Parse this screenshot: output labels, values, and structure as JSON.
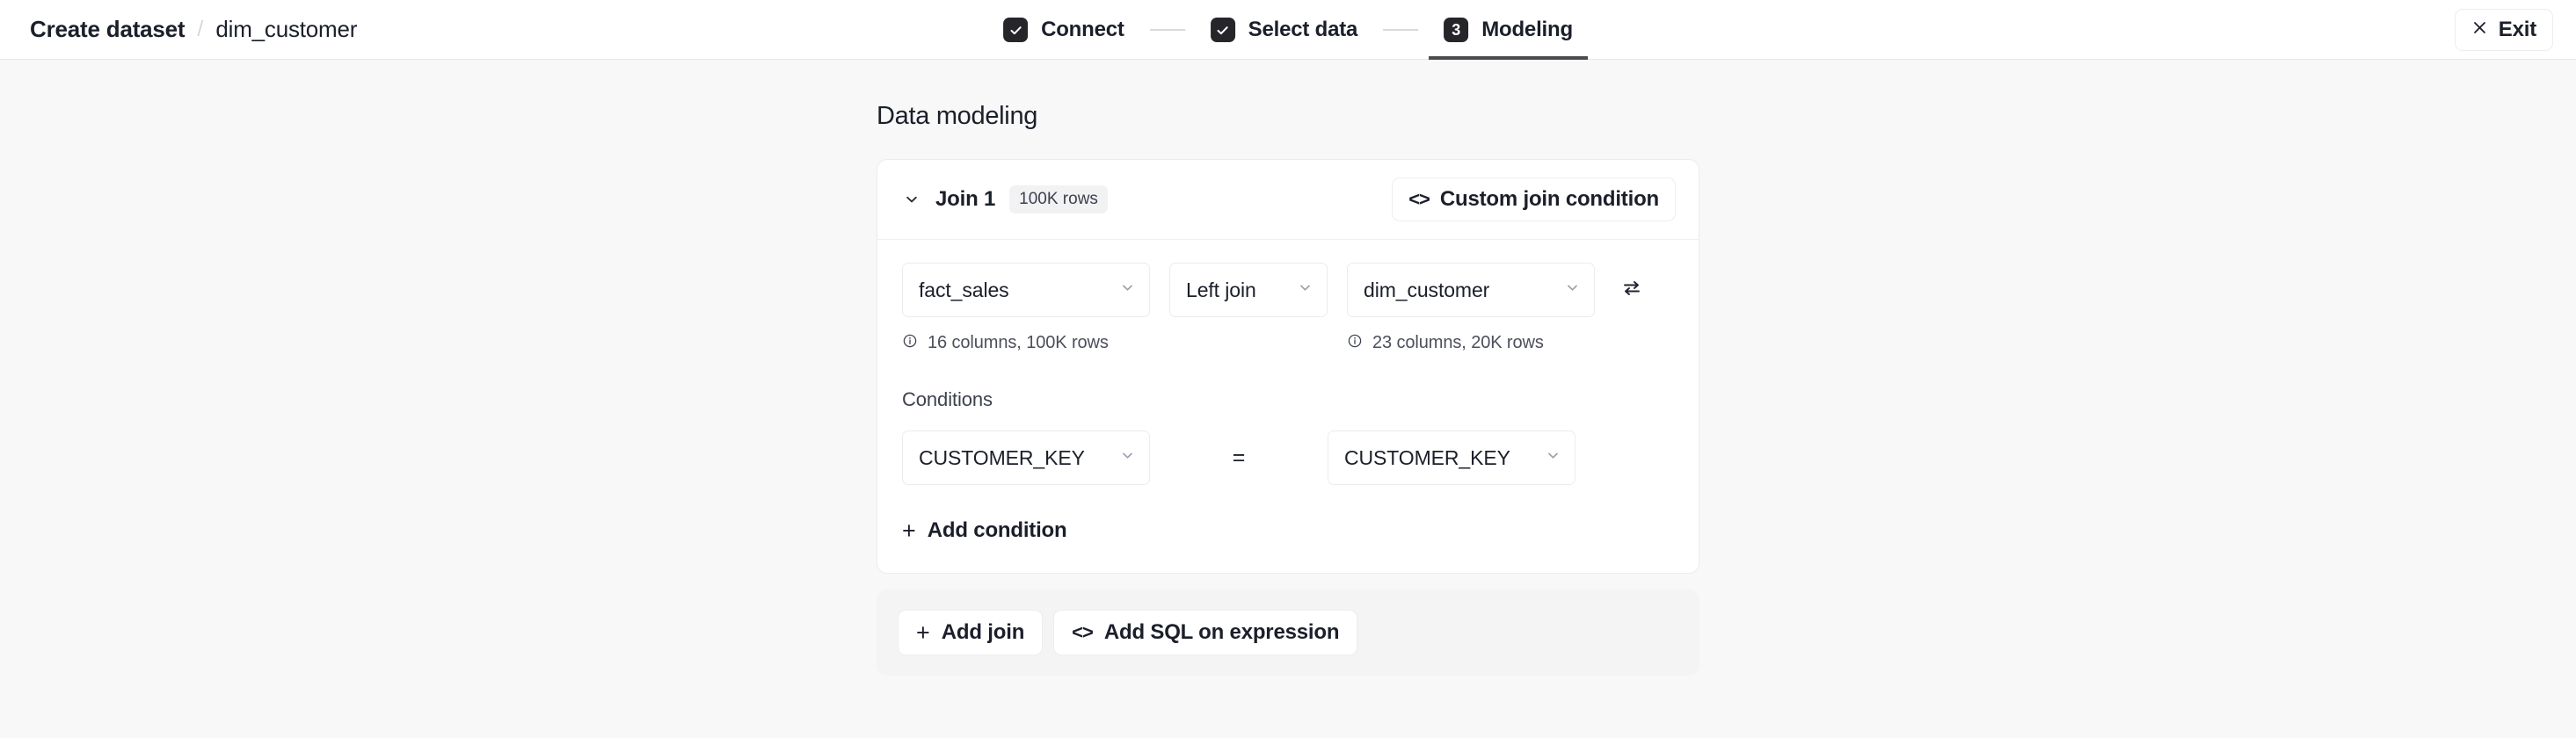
{
  "header": {
    "breadcrumb": {
      "root": "Create dataset",
      "separator": "/",
      "leaf": "dim_customer"
    },
    "steps": [
      {
        "label": "Connect",
        "marker": "check",
        "number": "",
        "state": "complete"
      },
      {
        "label": "Select data",
        "marker": "check",
        "number": "",
        "state": "complete"
      },
      {
        "label": "Modeling",
        "marker": "number",
        "number": "3",
        "state": "active"
      }
    ],
    "exit_button": {
      "label": "Exit",
      "icon": "close-icon"
    }
  },
  "main": {
    "title": "Data modeling",
    "join": {
      "collapse_icon": "chevron-down-icon",
      "title": "Join 1",
      "rows_badge": "100K rows",
      "custom_condition_button": {
        "label": "Custom join condition",
        "icon": "code-icon"
      },
      "left_table": {
        "value": "fact_sales",
        "meta": "16 columns, 100K rows"
      },
      "join_type": {
        "value": "Left join"
      },
      "right_table": {
        "value": "dim_customer",
        "meta": "23 columns, 20K rows"
      },
      "swap_icon": "swap-icon",
      "conditions_label": "Conditions",
      "conditions": [
        {
          "left": "CUSTOMER_KEY",
          "operator": "=",
          "right": "CUSTOMER_KEY"
        }
      ],
      "add_condition_button": {
        "label": "Add condition",
        "icon": "plus-icon"
      }
    },
    "footer_actions": [
      {
        "label": "Add join",
        "icon": "plus-icon"
      },
      {
        "label": "Add SQL on expression",
        "icon": "code-icon"
      }
    ]
  },
  "colors": {
    "page_background": "#f8f8f9",
    "surface": "#ffffff",
    "border": "#ececee",
    "text_primary": "#1b1f2a",
    "text_muted": "#4b4f5a",
    "marker_dark": "#26262a",
    "badge_background": "#f2f2f4",
    "footer_background": "#f4f4f5"
  }
}
